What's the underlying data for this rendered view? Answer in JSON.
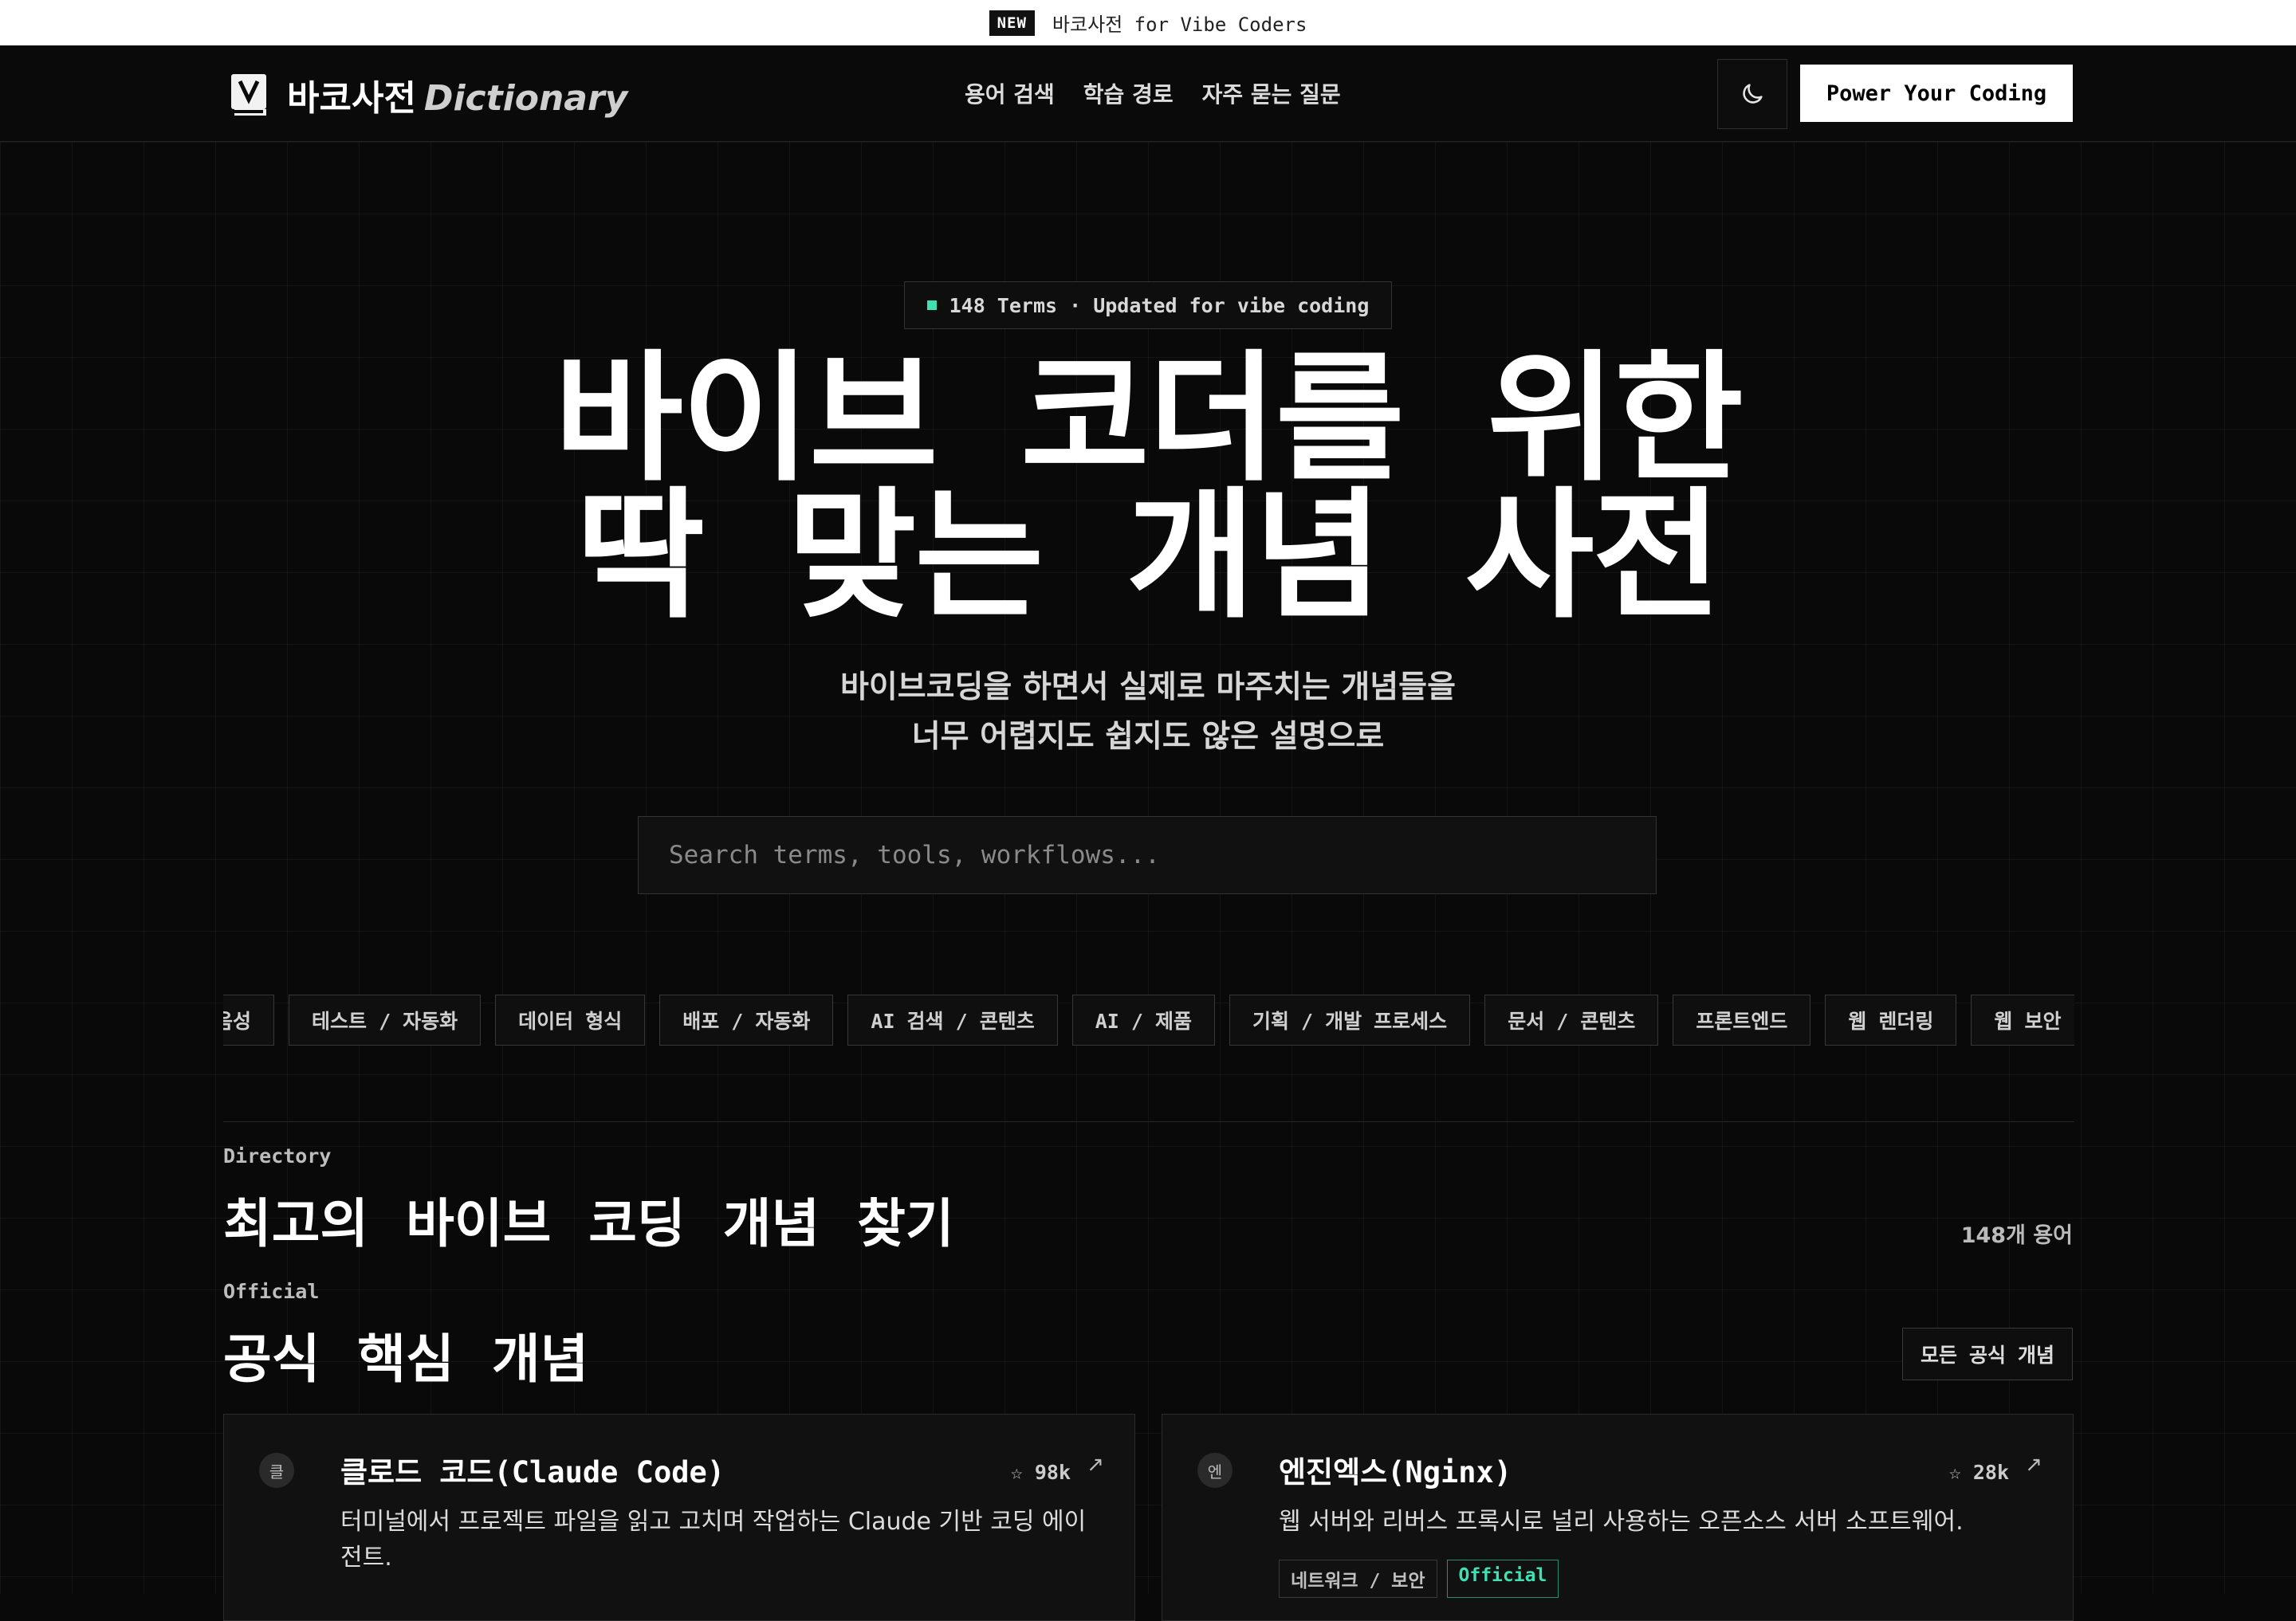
{
  "announcement": {
    "badge": "NEW",
    "text": "바코사전 for Vibe Coders"
  },
  "header": {
    "logo_text": "바코사전",
    "logo_text_en": "Dictionary",
    "nav": [
      "용어 검색",
      "학습 경로",
      "자주 묻는 질문"
    ],
    "theme_icon": "moon-icon",
    "cta_label": "Power Your Coding"
  },
  "hero": {
    "pill": "148 Terms · Updated for vibe coding",
    "title_line1": "바이브 코더를 위한",
    "title_line2": "딱 맞는 개념 사전",
    "sub_line1": "바이브코딩을 하면서 실제로 마주치는 개념들을",
    "sub_line2": "너무 어렵지도 쉽지도 않은 설명으로",
    "search_placeholder": "Search terms, tools, workflows..."
  },
  "tags": [
    "음성",
    "테스트 / 자동화",
    "데이터 형식",
    "배포 / 자동화",
    "AI 검색 / 콘텐츠",
    "AI / 제품",
    "기획 / 개발 프로세스",
    "문서 / 콘텐츠",
    "프론트엔드",
    "웹 렌더링",
    "웹 보안"
  ],
  "directory": {
    "eyebrow": "Directory",
    "title": "최고의 바이브 코딩 개념 찾기",
    "count": "148개 용어"
  },
  "official": {
    "eyebrow": "Official",
    "title": "공식 핵심 개념",
    "all_button": "모든 공식 개념",
    "cards": [
      {
        "avatar": "클",
        "title": "클로드 코드(Claude Code)",
        "stars": "☆ 98k",
        "desc": "터미널에서 프로젝트 파일을 읽고 고치며 작업하는 Claude 기반 코딩 에이전트.",
        "chips": []
      },
      {
        "avatar": "엔",
        "title": "엔진엑스(Nginx)",
        "stars": "☆ 28k",
        "desc": "웹 서버와 리버스 프록시로 널리 사용하는 오픈소스 서버 소프트웨어.",
        "chips": [
          "네트워크 / 보안",
          "Official"
        ]
      }
    ]
  },
  "colors": {
    "accent": "#3fe0b2",
    "background": "#090909",
    "cta_bg": "#ffffff"
  }
}
